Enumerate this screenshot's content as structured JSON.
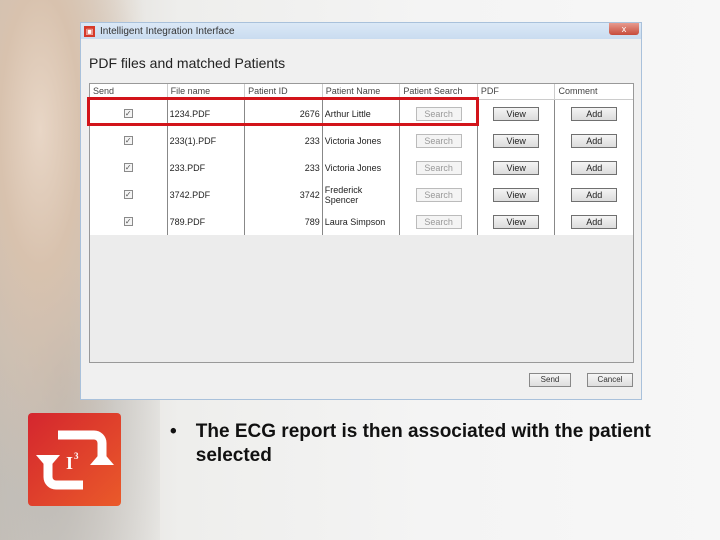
{
  "window": {
    "title": "Intelligent Integration Interface",
    "close": "x",
    "heading": "PDF files and matched Patients"
  },
  "table": {
    "headers": [
      "Send",
      "File name",
      "Patient ID",
      "Patient Name",
      "Patient Search",
      "PDF",
      "Comment"
    ],
    "rows": [
      {
        "file": "1234.PDF",
        "id": "2676",
        "name": "Arthur Little",
        "search": "Search",
        "pdf": "View",
        "comment": "Add",
        "checked": true
      },
      {
        "file": "233(1).PDF",
        "id": "233",
        "name": "Victoria Jones",
        "search": "Search",
        "pdf": "View",
        "comment": "Add",
        "checked": true
      },
      {
        "file": "233.PDF",
        "id": "233",
        "name": "Victoria Jones",
        "search": "Search",
        "pdf": "View",
        "comment": "Add",
        "checked": true
      },
      {
        "file": "3742.PDF",
        "id": "3742",
        "name": "Frederick Spencer",
        "search": "Search",
        "pdf": "View",
        "comment": "Add",
        "checked": true
      },
      {
        "file": "789.PDF",
        "id": "789",
        "name": "Laura Simpson",
        "search": "Search",
        "pdf": "View",
        "comment": "Add",
        "checked": true
      }
    ]
  },
  "footer": {
    "send": "Send",
    "cancel": "Cancel"
  },
  "slide": {
    "bullet": "The ECG report is then associated with the patient selected",
    "logo_text": "I3"
  },
  "colors": {
    "highlight": "#d2141a",
    "logo": "#e04a2a"
  }
}
